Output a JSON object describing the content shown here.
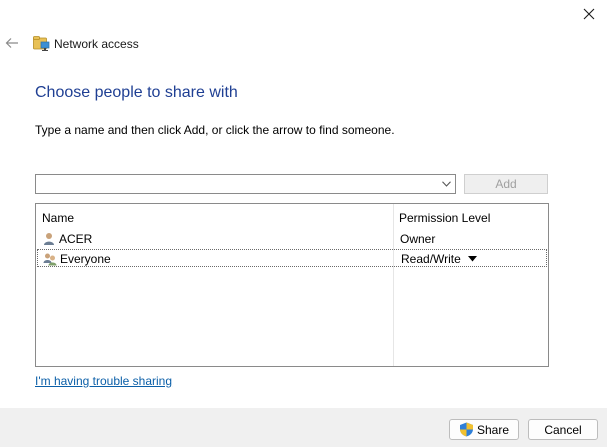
{
  "window": {
    "title": "Network access",
    "close_icon": "close-icon",
    "back_icon": "back-arrow-icon"
  },
  "content": {
    "heading": "Choose people to share with",
    "instruction": "Type a name and then click Add, or click the arrow to find someone.",
    "name_input": {
      "value": "",
      "placeholder": ""
    },
    "add_label": "Add"
  },
  "list": {
    "columns": [
      "Name",
      "Permission Level"
    ],
    "rows": [
      {
        "name": "ACER",
        "permission": "Owner",
        "icon": "user-icon"
      },
      {
        "name": "Everyone",
        "permission": "Read/Write",
        "icon": "group-icon",
        "selected": true
      }
    ]
  },
  "trouble_link": "I'm having trouble sharing",
  "footer": {
    "share_label": "Share",
    "cancel_label": "Cancel"
  },
  "colors": {
    "heading": "#1f3f93",
    "link": "#0b5fa8",
    "footer_bg": "#f0f0f0"
  }
}
